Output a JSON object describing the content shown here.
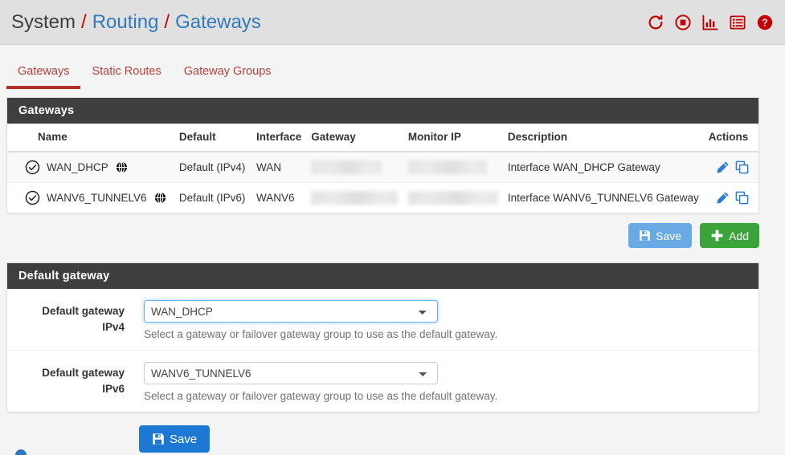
{
  "header": {
    "breadcrumb": [
      {
        "label": "System",
        "type": "text"
      },
      {
        "label": "Routing",
        "type": "link"
      },
      {
        "label": "Gateways",
        "type": "link"
      }
    ],
    "separator": "/",
    "icons": [
      {
        "name": "reload-icon",
        "title": "Reload"
      },
      {
        "name": "stop-icon",
        "title": "Stop"
      },
      {
        "name": "chart-icon",
        "title": "Status Monitoring"
      },
      {
        "name": "log-icon",
        "title": "Logs"
      },
      {
        "name": "help-icon",
        "title": "Help"
      }
    ],
    "icon_color": "#c30303",
    "background": "#e0e0e0"
  },
  "tabs": [
    {
      "label": "Gateways",
      "active": true
    },
    {
      "label": "Static Routes",
      "active": false
    },
    {
      "label": "Gateway Groups",
      "active": false
    }
  ],
  "tab_accent": "#b0302a",
  "gateways_panel": {
    "title": "Gateways",
    "columns": [
      "Name",
      "Default",
      "Interface",
      "Gateway",
      "Monitor IP",
      "Description",
      "Actions"
    ],
    "rows": [
      {
        "status": "enabled",
        "name": "WAN_DHCP",
        "has_globe": true,
        "default": "Default (IPv4)",
        "interface": "WAN",
        "gateway": "",
        "gateway_redacted": true,
        "monitor_ip": "",
        "monitor_redacted": true,
        "description": "Interface WAN_DHCP Gateway",
        "actions": [
          "edit",
          "copy"
        ]
      },
      {
        "status": "enabled",
        "name": "WANV6_TUNNELV6",
        "has_globe": true,
        "default": "Default (IPv6)",
        "interface": "WANV6",
        "gateway": "",
        "gateway_redacted": true,
        "monitor_ip": "",
        "monitor_redacted": true,
        "description": "Interface WANV6_TUNNELV6 Gateway",
        "actions": [
          "edit",
          "copy"
        ]
      }
    ]
  },
  "table_buttons": {
    "save_label": "Save",
    "save_color": "#6aaae4",
    "add_label": "Add",
    "add_color": "#3aa43a"
  },
  "default_gateway_panel": {
    "title": "Default gateway",
    "fields": [
      {
        "label_line1": "Default gateway",
        "label_line2": "IPv4",
        "value": "WAN_DHCP",
        "options": [
          "WAN_DHCP",
          "WANV6_TUNNELV6"
        ],
        "focused": true,
        "help": "Select a gateway or failover gateway group to use as the default gateway."
      },
      {
        "label_line1": "Default gateway",
        "label_line2": "IPv6",
        "value": "WANV6_TUNNELV6",
        "options": [
          "WAN_DHCP",
          "WANV6_TUNNELV6"
        ],
        "focused": false,
        "help": "Select a gateway or failover gateway group to use as the default gateway."
      }
    ]
  },
  "bottom_button": {
    "save_label": "Save",
    "save_color": "#1d78d4"
  }
}
